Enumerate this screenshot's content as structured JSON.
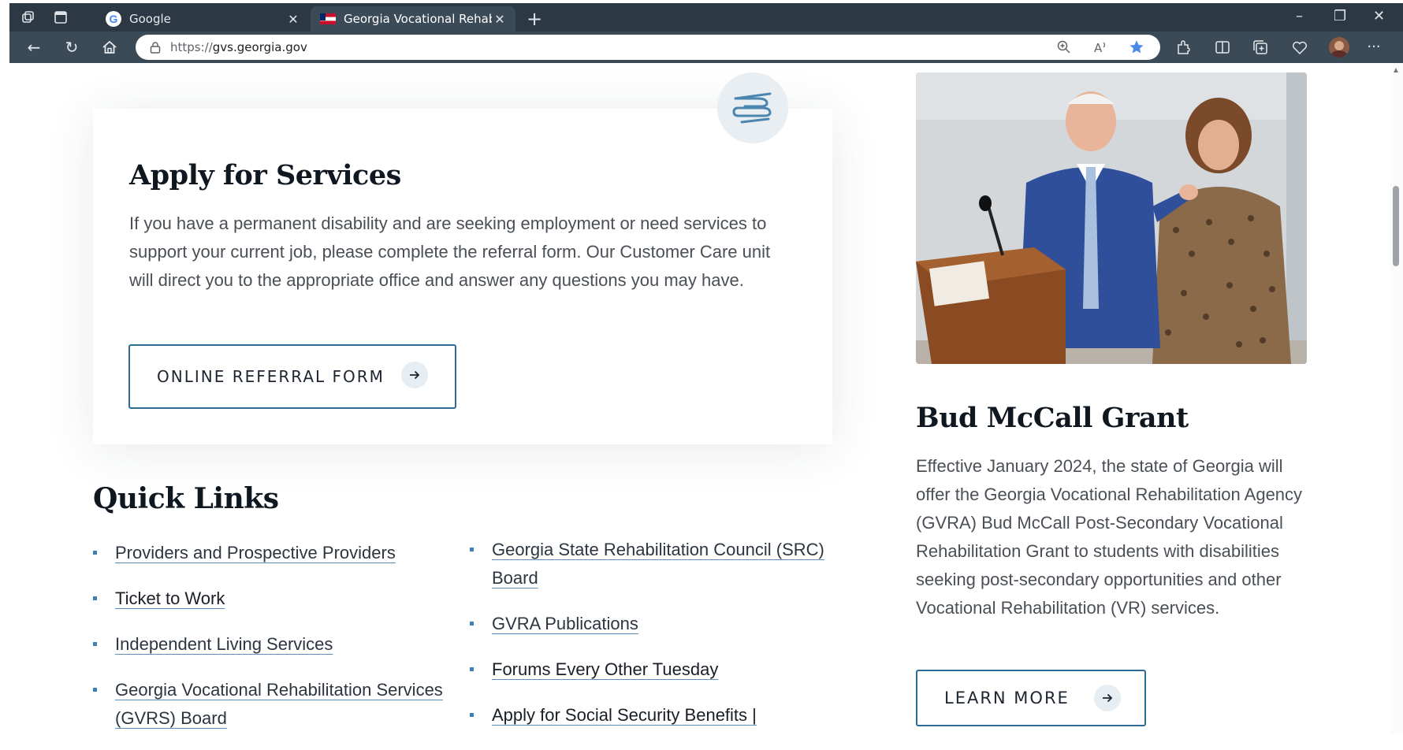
{
  "browser": {
    "tabs": [
      {
        "title": "Google",
        "active": false,
        "favicon": "google-icon"
      },
      {
        "title": "Georgia Vocational Rehabilitation Agency",
        "active": true,
        "favicon": "georgia-flag-icon"
      }
    ],
    "new_tab": "+",
    "window_controls": {
      "minimize": "–",
      "restore": "❐",
      "close": "✕"
    },
    "url_prefix": "https://",
    "url_host": "gvs.georgia.gov",
    "icons": [
      "back-icon",
      "refresh-icon",
      "home-icon",
      "lock-icon",
      "zoom-icon",
      "read-aloud-icon",
      "favorite-star-icon",
      "extensions-icon",
      "split-screen-icon",
      "collections-icon",
      "browser-essentials-icon",
      "profile-avatar",
      "more-menu-icon"
    ]
  },
  "apply": {
    "title": "Apply for Services",
    "body": "If you have a permanent disability and are seeking employment or need services to support your current job, please complete the referral form. Our Customer Care unit will direct you to the appropriate office and answer any questions you may have.",
    "button_label": "ONLINE REFERRAL FORM",
    "icon": "helping-hand-icon"
  },
  "quick_links": {
    "title": "Quick Links",
    "column1": [
      "Providers and Prospective Providers",
      "Ticket to Work",
      "Independent Living Services",
      "Georgia Vocational Rehabilitation Services (GVRS) Board"
    ],
    "column2": [
      "Georgia State Rehabilitation Council (SRC) Board",
      "GVRA Publications",
      "Forums Every Other Tuesday",
      "Apply for Social Security Benefits |"
    ]
  },
  "grant": {
    "title": "Bud McCall Grant",
    "body": "Effective January 2024, the state of Georgia will offer the Georgia Vocational Rehabilitation Agency (GVRA) Bud McCall Post-Secondary Vocational Rehabilitation Grant to students with disabilities seeking post-secondary opportunities and other Vocational Rehabilitation (VR) services.",
    "button_label": "LEARN MORE"
  },
  "colors": {
    "accent": "#2d6a96",
    "chrome_dark": "#2c3944",
    "chrome_mid": "#3b4a57",
    "favorite_star": "#4a8be8"
  }
}
